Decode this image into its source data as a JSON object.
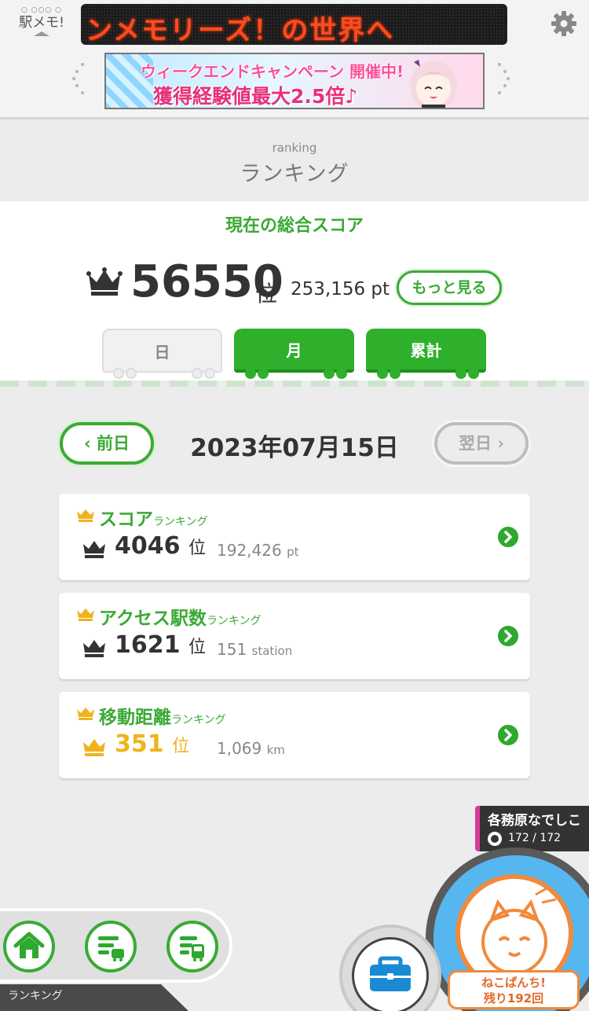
{
  "header": {
    "logo_text": "駅メモ!",
    "ticker_text": "ンメモリーズ！の世界へ",
    "banner": {
      "line1": "ウィークエンドキャンペーン 開催中!",
      "line2": "獲得経験値最大2.5倍♪"
    }
  },
  "page": {
    "subtitle": "ranking",
    "title": "ランキング"
  },
  "total": {
    "title": "現在の総合スコア",
    "rank": "56550",
    "rank_suffix": "位",
    "points": "253,156 pt",
    "more_label": "もっと見る",
    "tabs": [
      "日",
      "月",
      "累計"
    ],
    "active_tab": "日"
  },
  "date_nav": {
    "prev_label": "前日",
    "date": "2023年07月15日",
    "next_label": "翌日"
  },
  "rankings": [
    {
      "category": "スコア",
      "category_suffix": "ランキング",
      "rank": "4046",
      "rank_suffix": "位",
      "value": "192,426",
      "unit": "pt"
    },
    {
      "category": "アクセス駅数",
      "category_suffix": "ランキング",
      "rank": "1621",
      "rank_suffix": "位",
      "value": "151",
      "unit": "station"
    },
    {
      "category": "移動距離",
      "category_suffix": "ランキング",
      "rank": "351",
      "rank_suffix": "位",
      "value": "1,069",
      "unit": "km"
    }
  ],
  "station": {
    "name": "各務原なでしこ",
    "count": "172 / 172"
  },
  "neko": {
    "label_line1": "ねこぱんち!",
    "label_line2": "残り192回"
  },
  "bottom_nav": {
    "label": "ランキング"
  },
  "colors": {
    "accent_green": "#3aaa35",
    "gold": "#f1b31c",
    "led_text": "#ff4b1f",
    "station_line": "#d93a9a",
    "neko_orange": "#f08a3c"
  }
}
